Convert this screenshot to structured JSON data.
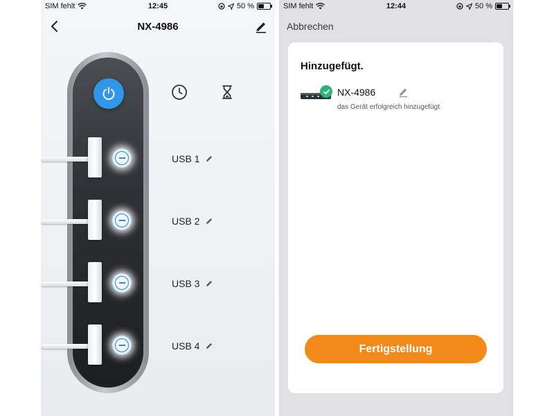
{
  "left_screen": {
    "status": {
      "carrier": "SIM fehlt",
      "time": "12:45",
      "battery_text": "50 %",
      "battery_level": 0.5
    },
    "nav": {
      "title": "NX-4986",
      "back_icon": "chevron-left-icon",
      "edit_icon": "pencil-icon"
    },
    "controls": {
      "power_icon": "power-icon",
      "power_color": "#2f96e8",
      "schedule_icon": "clock-icon",
      "timer_icon": "hourglass-icon"
    },
    "ports": [
      {
        "label": "USB 1",
        "state": "on"
      },
      {
        "label": "USB 2",
        "state": "on"
      },
      {
        "label": "USB 3",
        "state": "on"
      },
      {
        "label": "USB 4",
        "state": "on"
      }
    ]
  },
  "right_screen": {
    "status": {
      "carrier": "SIM fehlt",
      "time": "12:44",
      "battery_text": "50 %",
      "battery_level": 0.5
    },
    "cancel_label": "Abbrechen",
    "card": {
      "heading": "Hinzugefügt.",
      "device_name": "NX-4986",
      "device_status": "das Gerät erfolgreich hinzugefügt",
      "status_icon": "checkmark-icon",
      "status_color": "#2bb673"
    },
    "finish_label": "Fertigstellung",
    "accent_color": "#f28a1a"
  }
}
